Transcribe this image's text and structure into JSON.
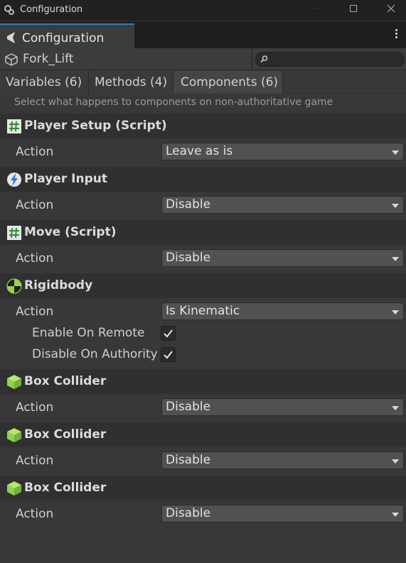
{
  "window": {
    "title": "Configuration"
  },
  "tab": {
    "label": "Configuration"
  },
  "object": {
    "name": "Fork_Lift"
  },
  "search": {
    "placeholder": "",
    "value": ""
  },
  "subtabs": [
    {
      "label": "Variables (6)"
    },
    {
      "label": "Methods (4)"
    },
    {
      "label": "Components (6)"
    }
  ],
  "hint": "Select what happens to components on non-authoritative game",
  "action_label": "Action",
  "components": [
    {
      "title": "Player Setup (Script)",
      "icon": "script-icon",
      "action": "Leave as is"
    },
    {
      "title": "Player Input",
      "icon": "player-input-icon",
      "action": "Disable"
    },
    {
      "title": "Move (Script)",
      "icon": "script-icon",
      "action": "Disable"
    },
    {
      "title": "Rigidbody",
      "icon": "rigidbody-icon",
      "action": "Is Kinematic",
      "options": [
        {
          "label": "Enable On Remote",
          "checked": true
        },
        {
          "label": "Disable On Authority",
          "checked": true
        }
      ]
    },
    {
      "title": "Box Collider",
      "icon": "box-collider-icon",
      "action": "Disable"
    },
    {
      "title": "Box Collider",
      "icon": "box-collider-icon",
      "action": "Disable"
    },
    {
      "title": "Box Collider",
      "icon": "box-collider-icon",
      "action": "Disable"
    }
  ],
  "colors": {
    "script_icon_bg": "#e6e6e6",
    "script_icon_fg": "#2e8a3a",
    "collider_green": "#8fd14f",
    "tab_accent": "#3a79bb"
  }
}
